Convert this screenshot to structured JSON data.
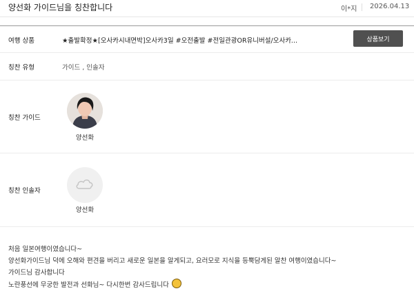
{
  "header": {
    "title": "양선화 가이드님을 칭찬합니다",
    "author": "이*지",
    "date": "2026.04.13"
  },
  "product": {
    "label": "여행 상품",
    "value": "★출발확정★[오사카시내면박]오사카3일 #오전출발 #전일관광OR유니버설/오사카...",
    "button_label": "상품보기"
  },
  "praise_type": {
    "label": "칭찬 유형",
    "value": "가이드 , 인솔자"
  },
  "guide": {
    "label": "칭찬 가이드",
    "name": "양선화",
    "avatar_icon": "guide-photo"
  },
  "escort": {
    "label": "칭찬 인솔자",
    "name": "양선화",
    "avatar_icon": "cloud-icon"
  },
  "body": {
    "lines": [
      "처음 일본여행이였습니다~",
      "양선화가이드님 덕에 오해와 편견을 버리고 새로운 일본을 알게되고, 요러모로 지식을 등뿍담게된 알찬 여행이였습니다~",
      "가이드님 감사합니다",
      "노란풍선에 무궁한 발전과 선화님~ 다시한번 감사드립니다"
    ],
    "emoji_icon": "grinning-face-icon"
  }
}
